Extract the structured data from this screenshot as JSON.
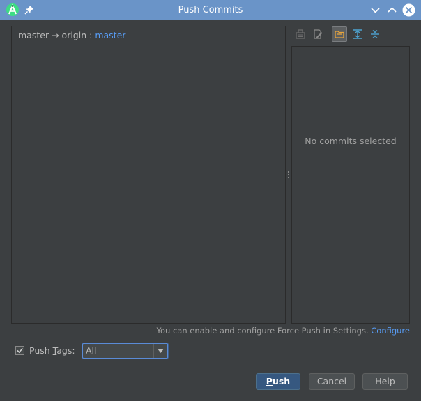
{
  "window": {
    "title": "Push Commits"
  },
  "push_spec": {
    "local_branch": "master",
    "arrow": "→",
    "remote": "origin",
    "separator": ":",
    "remote_branch": "master"
  },
  "details": {
    "empty_text": "No commits selected"
  },
  "force_push": {
    "note": "You can enable and configure Force Push in Settings.",
    "link": "Configure"
  },
  "push_tags": {
    "checked": true,
    "label_prefix": "Push ",
    "label_mnemonic": "T",
    "label_suffix": "ags:",
    "selected": "All"
  },
  "buttons": {
    "push_mnemonic": "P",
    "push_rest": "ush",
    "cancel": "Cancel",
    "help": "Help"
  },
  "colors": {
    "titlebar": "#6a94c8",
    "background": "#3c3f41",
    "link": "#589df6",
    "default_button": "#365880"
  }
}
